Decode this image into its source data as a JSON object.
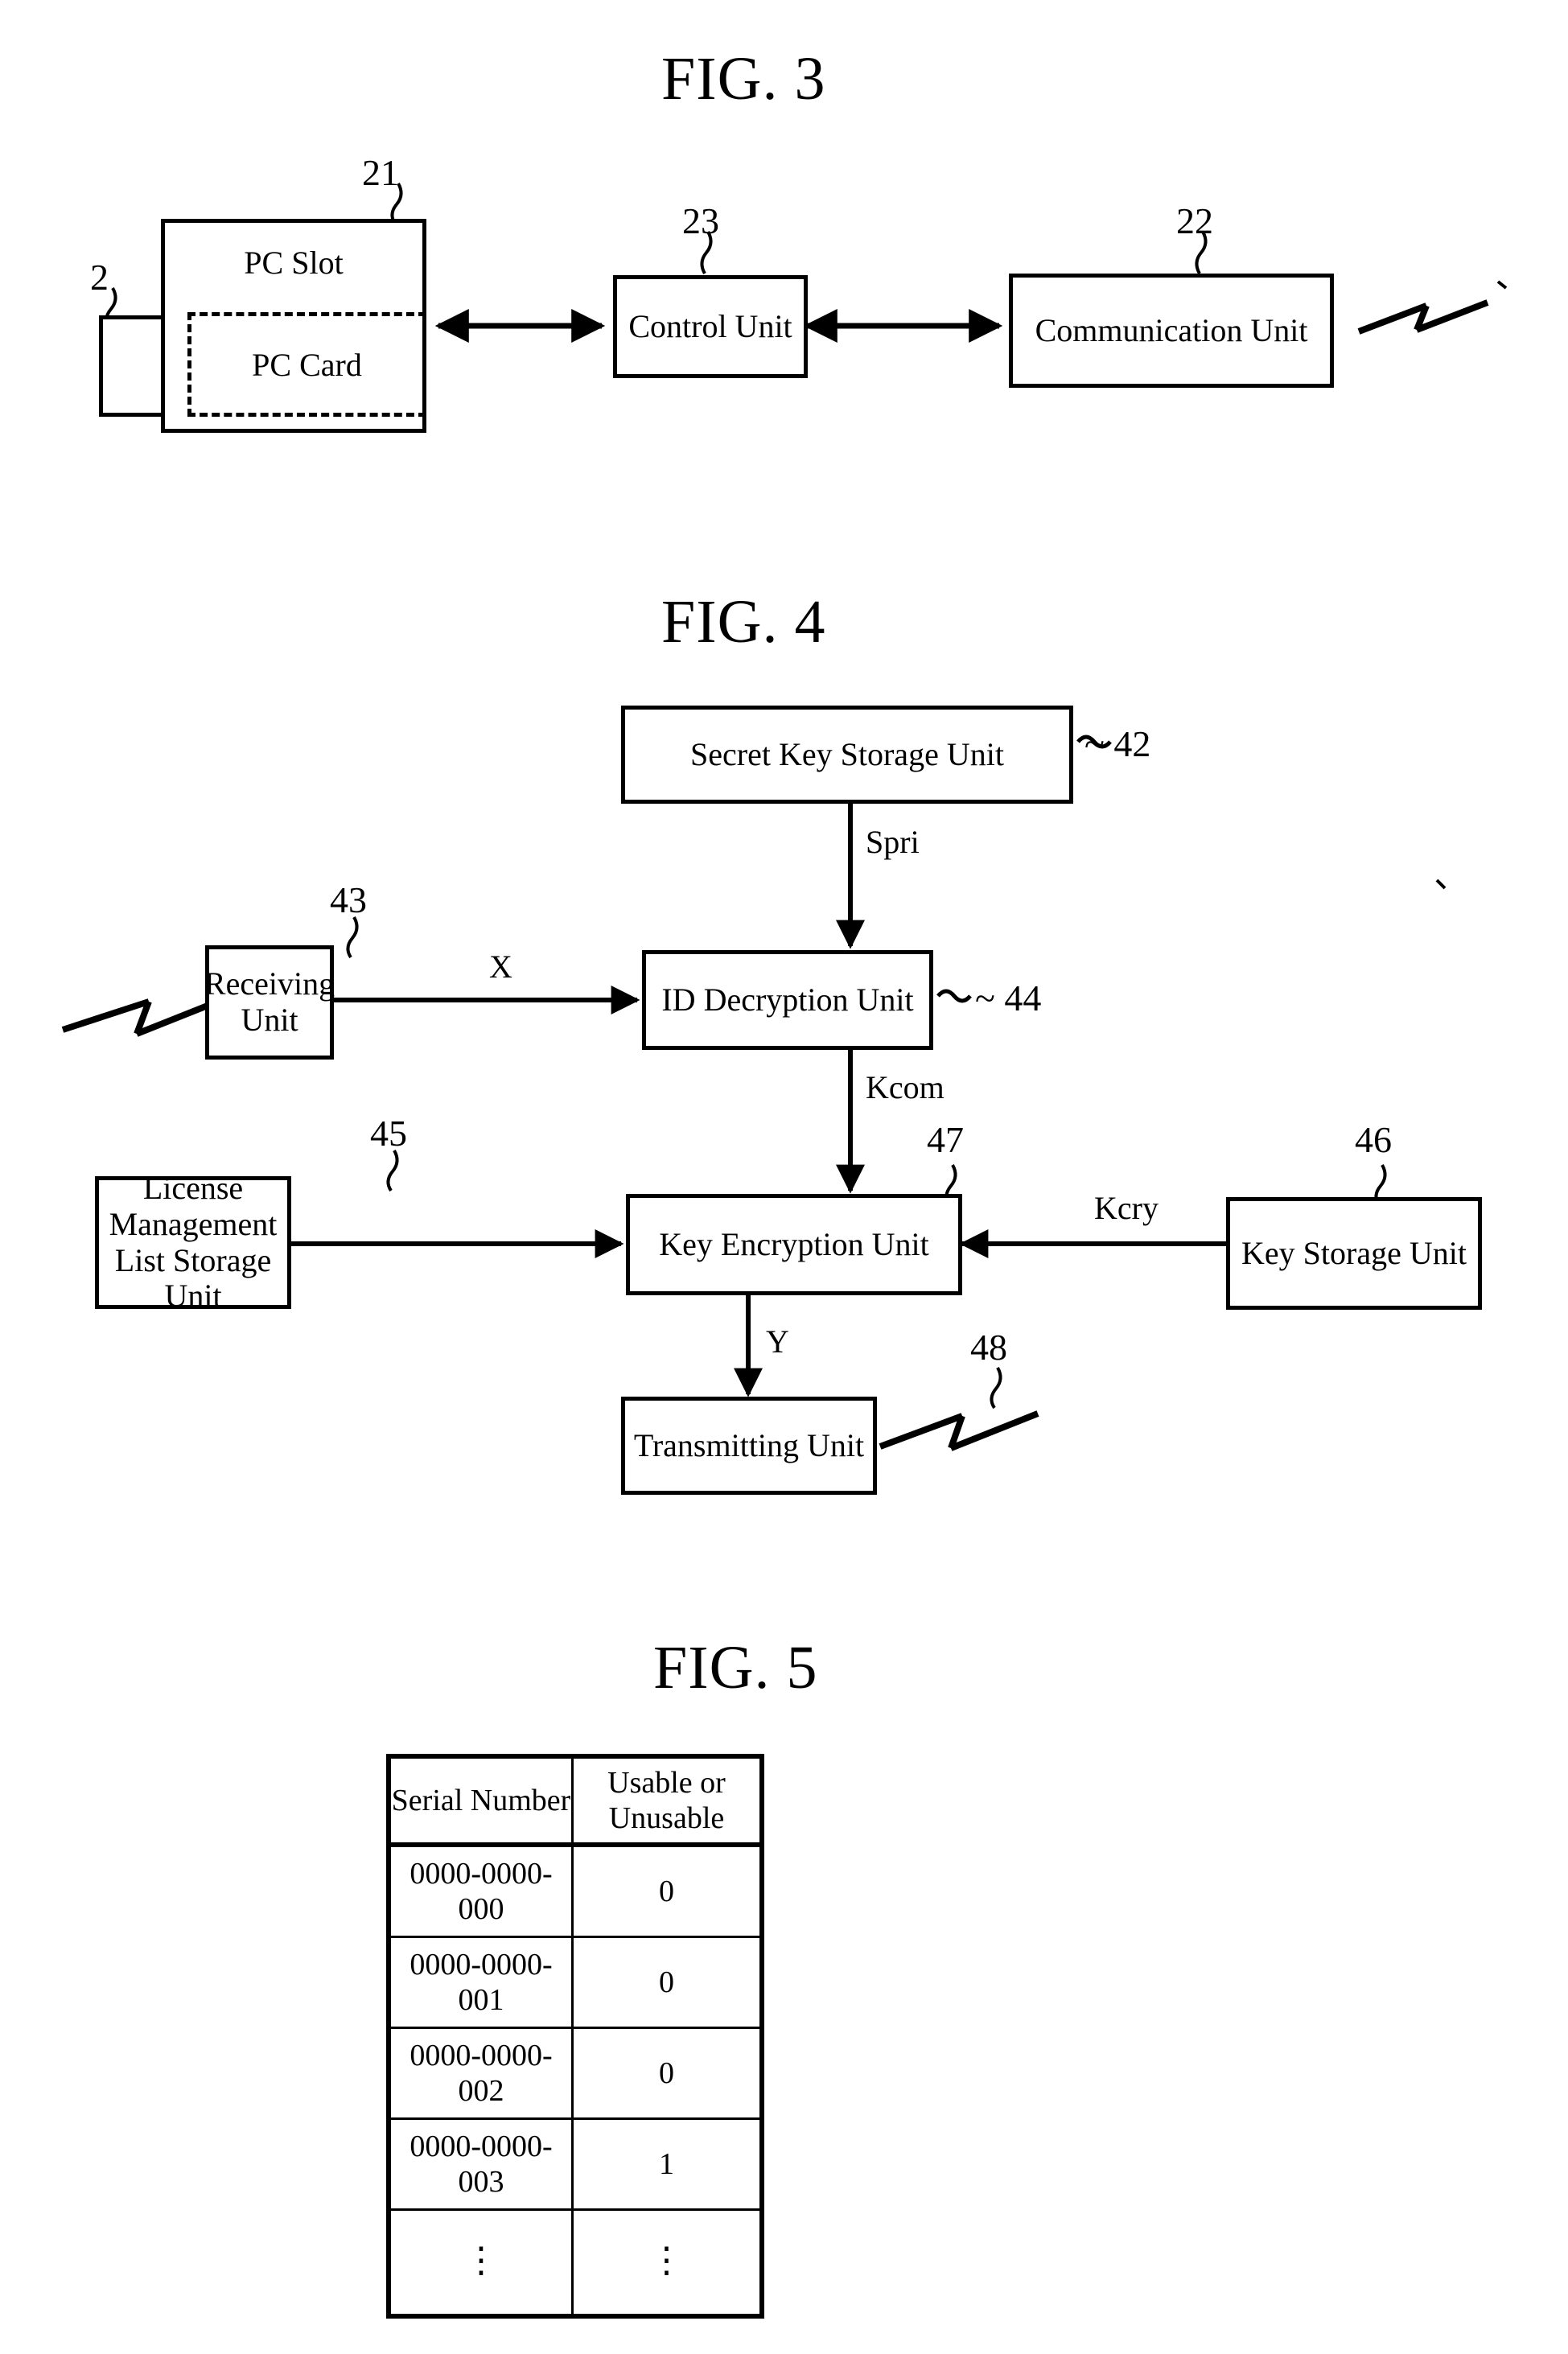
{
  "figures": [
    {
      "title": "FIG. 3",
      "id": "fig3",
      "blocks": [
        {
          "id": "pc-slot",
          "label": "PC Slot",
          "ref": "21"
        },
        {
          "id": "pc-card",
          "label": "PC Card",
          "ref": ""
        },
        {
          "id": "card-tab",
          "label": "",
          "ref": "2"
        },
        {
          "id": "control-unit",
          "label": "Control Unit",
          "ref": "23"
        },
        {
          "id": "communication-unit",
          "label": "Communication Unit",
          "ref": "22"
        }
      ],
      "antenna": "lightning-bolt"
    },
    {
      "title": "FIG. 4",
      "id": "fig4",
      "blocks": [
        {
          "id": "secret-key-storage-unit",
          "label": "Secret Key Storage Unit",
          "ref": "42"
        },
        {
          "id": "receiving-unit",
          "label": "Receiving Unit",
          "ref": "43"
        },
        {
          "id": "id-decryption-unit",
          "label": "ID Decryption Unit",
          "ref": "44"
        },
        {
          "id": "license-management-list-storage-unit",
          "label": "License Management List Storage Unit",
          "ref": "45"
        },
        {
          "id": "key-encryption-unit",
          "label": "Key Encryption Unit",
          "ref": "47"
        },
        {
          "id": "key-storage-unit",
          "label": "Key Storage Unit",
          "ref": "46"
        },
        {
          "id": "transmitting-unit",
          "label": "Transmitting Unit",
          "ref": "48"
        }
      ],
      "signals": [
        {
          "id": "spri",
          "label": "Spri"
        },
        {
          "id": "x",
          "label": "X"
        },
        {
          "id": "kcom",
          "label": "Kcom"
        },
        {
          "id": "kcry",
          "label": "Kcry"
        },
        {
          "id": "y",
          "label": "Y"
        }
      ]
    },
    {
      "title": "FIG. 5",
      "id": "fig5"
    }
  ],
  "fig3": {
    "title": "FIG. 3",
    "pc_slot_label": "PC Slot",
    "pc_card_label": "PC Card",
    "control_unit_label": "Control Unit",
    "communication_unit_label": "Communication Unit",
    "ref_21": "21",
    "ref_2": "2",
    "ref_23": "23",
    "ref_22": "22"
  },
  "fig4": {
    "title": "FIG. 4",
    "secret_key_storage_unit_label": "Secret Key Storage Unit",
    "receiving_unit_label": "Receiving Unit",
    "id_decryption_unit_label": "ID Decryption Unit",
    "license_management_label": "License Management List Storage Unit",
    "key_encryption_unit_label": "Key Encryption Unit",
    "key_storage_unit_label": "Key Storage Unit",
    "transmitting_unit_label": "Transmitting Unit",
    "ref_42": "~ 42",
    "ref_43": "43",
    "ref_44": "~ 44",
    "ref_45": "45",
    "ref_46": "46",
    "ref_47": "47",
    "ref_48": "48",
    "signal_spri": "Spri",
    "signal_x": "X",
    "signal_kcom": "Kcom",
    "signal_kcry": "Kcry",
    "signal_y": "Y"
  },
  "fig5": {
    "title": "FIG. 5",
    "table": {
      "headers": [
        "Serial Number",
        "Usable or Unusable"
      ],
      "rows": [
        [
          "0000-0000-000",
          "0"
        ],
        [
          "0000-0000-001",
          "0"
        ],
        [
          "0000-0000-002",
          "0"
        ],
        [
          "0000-0000-003",
          "1"
        ],
        [
          "⋮",
          "⋮"
        ]
      ]
    }
  },
  "colors": {
    "ink": "#000000",
    "paper": "#ffffff"
  }
}
